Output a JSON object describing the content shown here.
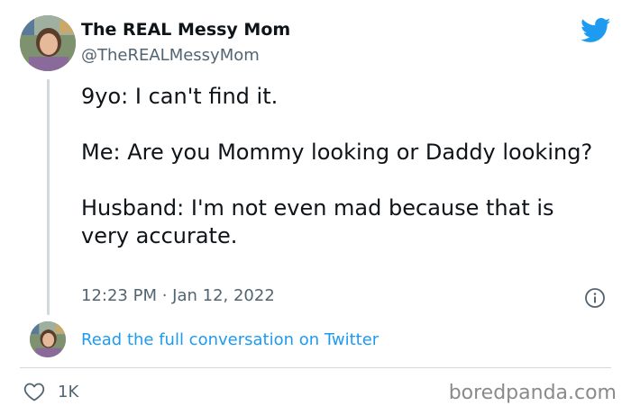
{
  "author": {
    "display_name": "The REAL Messy Mom",
    "handle": "@TheREALMessyMom"
  },
  "tweet": {
    "paragraphs": [
      "9yo: I can't find it.",
      "Me: Are you Mommy looking or Daddy looking?",
      "Husband: I'm not even mad because that is very accurate."
    ],
    "timestamp": "12:23 PM · Jan 12, 2022"
  },
  "conversation_link": "Read the full conversation on Twitter",
  "engagement": {
    "likes": "1K"
  },
  "watermark": "boredpanda.com",
  "icons": {
    "brand": "twitter-bird-icon",
    "info": "info-icon",
    "like": "heart-icon"
  },
  "colors": {
    "twitter_blue": "#1d9bf0",
    "text_primary": "#0f1419",
    "text_secondary": "#536471",
    "divider": "#cfd9de",
    "watermark": "#8a8a8a"
  }
}
